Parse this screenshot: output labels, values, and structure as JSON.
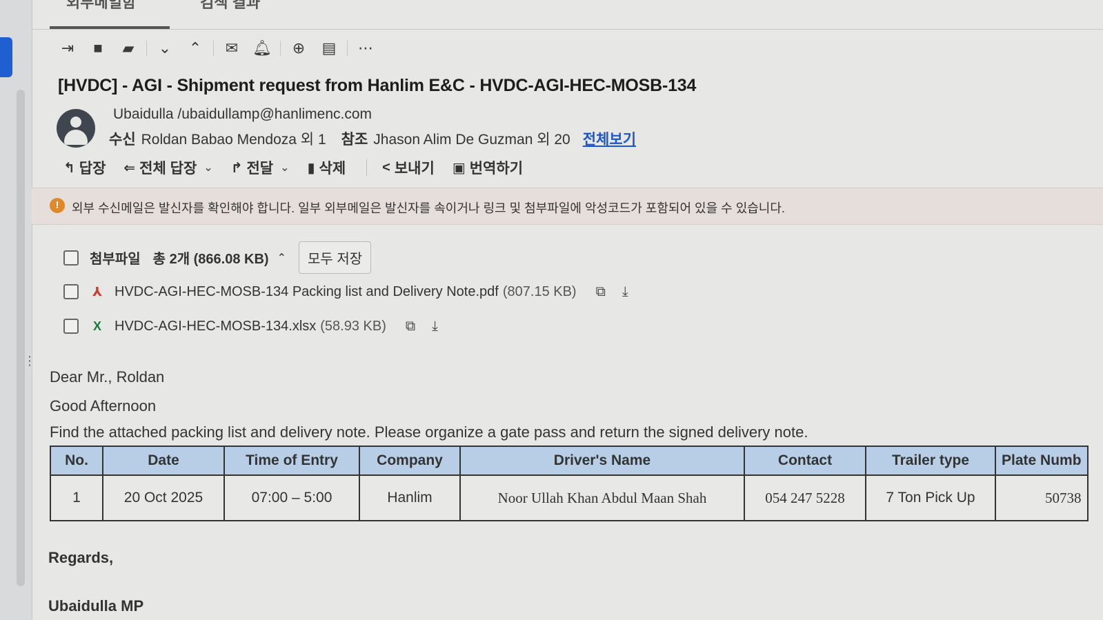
{
  "tabs": {
    "active": "외부메일함",
    "other": "검색 결과"
  },
  "toolbar": {
    "icons": [
      "move-to-icon",
      "archive-icon",
      "folder-icon",
      "chevron-down-icon",
      "chevron-up-icon",
      "mail-icon",
      "bell-icon",
      "zoom-icon",
      "book-icon",
      "more-icon"
    ]
  },
  "email": {
    "subject": "[HVDC] - AGI - Shipment request from Hanlim E&C - HVDC-AGI-HEC-MOSB-134",
    "sender_line": "Ubaidulla  /ubaidullamp@hanlimenc.com",
    "to_label": "수신",
    "to_value": "Roldan Babao Mendoza 외 1",
    "cc_label": "참조",
    "cc_value": "Jhason Alim De Guzman 외 20",
    "view_all": "전체보기"
  },
  "actions": {
    "reply": "답장",
    "reply_all": "전체 답장",
    "forward": "전달",
    "delete": "삭제",
    "send": "보내기",
    "translate": "번역하기"
  },
  "warning": {
    "text": "외부 수신메일은 발신자를 확인해야 합니다. 일부 외부메일은 발신자를 속이거나 링크 및 첨부파일에 악성코드가 포함되어 있을 수 있습니다."
  },
  "attachments": {
    "label": "첨부파일",
    "count": "총 2개 (866.08 KB)",
    "save_all": "모두 저장",
    "files": [
      {
        "name": "HVDC-AGI-HEC-MOSB-134 Packing list and Delivery Note.pdf",
        "size": "(807.15 KB)"
      },
      {
        "name": "HVDC-AGI-HEC-MOSB-134.xlsx",
        "size": "(58.93 KB)"
      }
    ]
  },
  "body": {
    "greeting": "Dear Mr., Roldan",
    "line2": "Good Afternoon",
    "line3": "Find the attached packing list and delivery note. Please organize a gate pass and return the signed delivery note.",
    "regards": "Regards,",
    "signature": "Ubaidulla MP"
  },
  "table": {
    "headers": [
      "No.",
      "Date",
      "Time of Entry",
      "Company",
      "Driver's Name",
      "Contact",
      "Trailer type",
      "Plate Numb"
    ],
    "rows": [
      [
        "1",
        "20 Oct 2025",
        "07:00 – 5:00",
        "Hanlim",
        "Noor Ullah Khan Abdul Maan Shah",
        "054 247 5228",
        "7 Ton Pick Up",
        "50738"
      ]
    ]
  }
}
